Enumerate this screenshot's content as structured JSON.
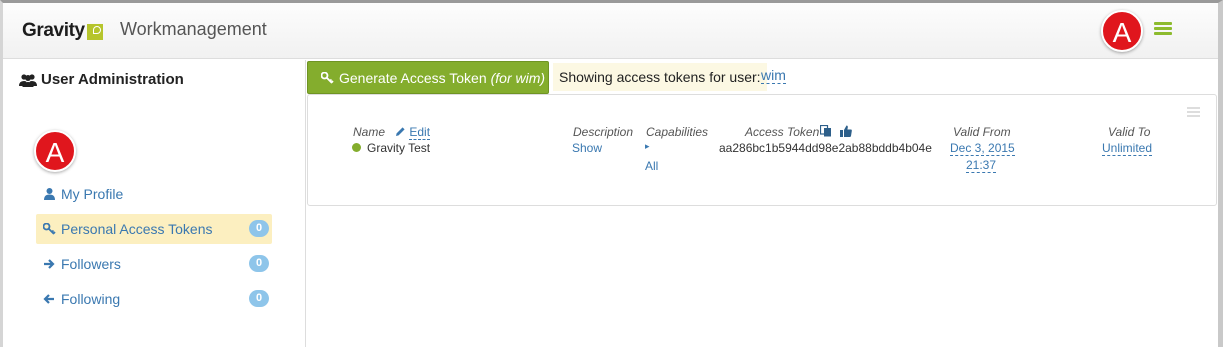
{
  "header": {
    "logo_text": "Gravity",
    "app_name": "Workmanagement",
    "avatar_letter": "A",
    "menu_icon": "hamburger-icon",
    "accent_color": "#8dbb2e",
    "avatar_color": "#e0161d"
  },
  "sidebar": {
    "title": "User Administration",
    "title_icon": "users-icon",
    "avatar_letter": "A",
    "items": [
      {
        "label": "My Profile",
        "icon": "user-icon"
      },
      {
        "label": "Personal Access Tokens",
        "icon": "key-icon",
        "badge": "0",
        "active": true
      },
      {
        "label": "Followers",
        "icon": "arrow-right-icon",
        "badge": "0"
      },
      {
        "label": "Following",
        "icon": "arrow-left-icon",
        "badge": "0"
      }
    ]
  },
  "toolbar": {
    "generate_label": "Generate Access Token",
    "generate_suffix": "(for wim)",
    "showing_label": "Showing access tokens for user:",
    "user": "wim"
  },
  "table": {
    "headers": {
      "name": "Name",
      "edit": "Edit",
      "description": "Description",
      "capabilities": "Capabilities",
      "access_token": "Access Token",
      "valid_from": "Valid From",
      "valid_to": "Valid To"
    },
    "rows": [
      {
        "name": "Gravity Test",
        "status_color": "#84ad2d",
        "description": "Show",
        "capabilities": "All",
        "access_token": "aa286bc1b5944dd98e2ab88bddb4b04e",
        "valid_from_date": "Dec 3, 2015",
        "valid_from_time": "21:37",
        "valid_to": "Unlimited"
      }
    ]
  }
}
